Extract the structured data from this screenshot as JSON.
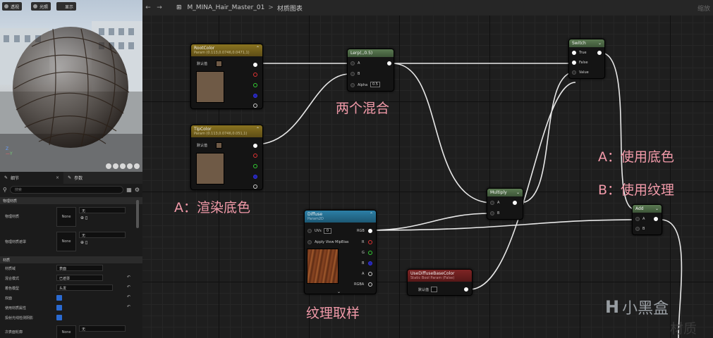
{
  "viewport": {
    "buttons": [
      "透视",
      "光照",
      "显示"
    ]
  },
  "details": {
    "tabs": [
      {
        "label": "细节",
        "close": "×"
      },
      {
        "label": "参数"
      }
    ],
    "search_placeholder": "搜索",
    "section_physical": "物理材质",
    "phys_material_label": "物理材质",
    "phys_mask_label": "物理材质遮罩",
    "thumb_none": "None",
    "none_value": "无",
    "section_material": "材质",
    "rows": [
      {
        "label": "材质域",
        "value": "表面"
      },
      {
        "label": "混合模式",
        "value": "已遮罩"
      },
      {
        "label": "着色模型",
        "value": "头发"
      },
      {
        "label": "双面",
        "value": ""
      },
      {
        "label": "使用材质属性",
        "value": ""
      },
      {
        "label": "投射光线检测阴影",
        "value": ""
      },
      {
        "label": "次表面轮廓",
        "value": "无"
      }
    ]
  },
  "topbar": {
    "title": "M_MINA_Hair_Master_01",
    "separator": ">",
    "section": "材质图表",
    "zoom": "缩放"
  },
  "nodes": {
    "root_color": {
      "title": "RootColor",
      "subtitle": "Param (0.113,0.0746,0.0471,1)",
      "default_label": "默认值"
    },
    "tip_color": {
      "title": "TipColor",
      "subtitle": "Param (0.113,0.0746,0.051,1)",
      "default_label": "默认值"
    },
    "lerp": {
      "title": "Lerp(,,0.5)",
      "pin_a": "A",
      "pin_b": "B",
      "alpha_label": "Alpha",
      "alpha_value": "0.5"
    },
    "switch": {
      "title": "Switch",
      "pin_true": "True",
      "pin_false": "False",
      "pin_value": "Value"
    },
    "multiply": {
      "title": "Multiply",
      "pin_a": "A",
      "pin_b": "B"
    },
    "add": {
      "title": "Add",
      "pin_a": "A",
      "pin_b": "B"
    },
    "diffuse": {
      "title": "Diffuse",
      "subtitle": "Param2D",
      "uvs_label": "UVs",
      "uvs_value": "0",
      "mip_label": "Apply View MipBias",
      "out_rgb": "RGB",
      "out_r": "R",
      "out_g": "G",
      "out_b": "B",
      "out_a": "A",
      "out_rgba": "RGBA"
    },
    "use_diffuse": {
      "title": "UseDiffuseBaseColor",
      "subtitle": "Static Bool Param (False)",
      "default_label": "默认值"
    }
  },
  "annotations": {
    "mix": "两个混合",
    "base": "A：渲染底色",
    "texture": "纹理取样",
    "use_a": "A：使用底色",
    "use_b": "B：使用纹理"
  },
  "watermark": {
    "brand": "小黑盒",
    "corner": "材质"
  },
  "colors": {
    "accent_annotation": "#f29aa9",
    "param_header": "#8a7421",
    "math_header": "#5b7a52",
    "texture_header": "#2c7fa6",
    "static_bool_header": "#7e2424",
    "swatch": "#6f5a46"
  }
}
